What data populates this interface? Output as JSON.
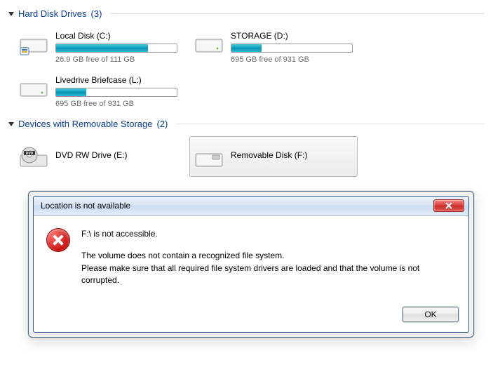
{
  "sections": {
    "hdd": {
      "title": "Hard Disk Drives",
      "count": "(3)"
    },
    "removable": {
      "title": "Devices with Removable Storage",
      "count": "(2)"
    }
  },
  "drives": {
    "c": {
      "label": "Local Disk (C:)",
      "free": "26.9 GB free of 111 GB",
      "fill_pct": 76
    },
    "d": {
      "label": "STORAGE (D:)",
      "free": "695 GB free of 931 GB",
      "fill_pct": 25
    },
    "l": {
      "label": "Livedrive Briefcase (L:)",
      "free": "695 GB free of 931 GB",
      "fill_pct": 25
    },
    "e": {
      "label": "DVD RW Drive (E:)"
    },
    "f": {
      "label": "Removable Disk (F:)"
    }
  },
  "dialog": {
    "title": "Location is not available",
    "line1": "F:\\ is not accessible.",
    "line2": "The volume does not contain a recognized file system.\nPlease make sure that all required file system drivers are loaded and that the volume is not corrupted.",
    "ok": "OK"
  }
}
